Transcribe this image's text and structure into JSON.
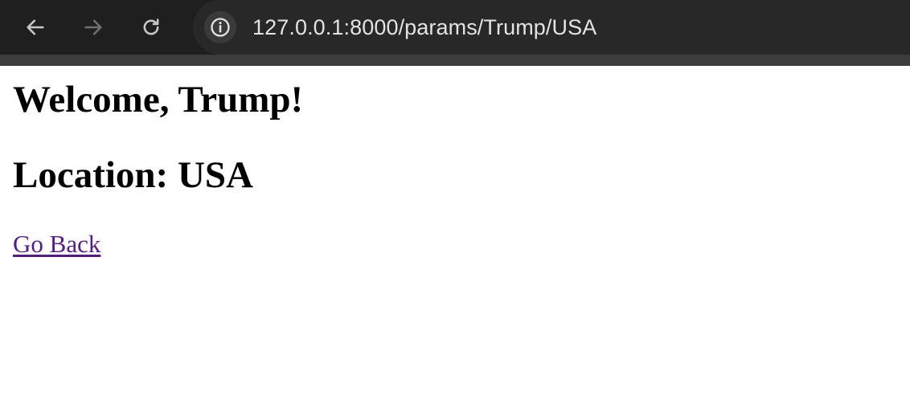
{
  "browser": {
    "url": "127.0.0.1:8000/params/Trump/USA",
    "back_icon": "arrow-left-icon",
    "forward_icon": "arrow-right-icon",
    "reload_icon": "reload-icon",
    "site_info_icon": "info-icon"
  },
  "page": {
    "welcome_heading": "Welcome, Trump!",
    "location_heading": "Location: USA",
    "back_link": "Go Back",
    "link_color": "#551a8b"
  },
  "colors": {
    "toolbar_bg": "#1f1f1f",
    "omnibox_bg": "#282828",
    "url_text": "#e3e3e3",
    "page_bg": "#ffffff"
  }
}
